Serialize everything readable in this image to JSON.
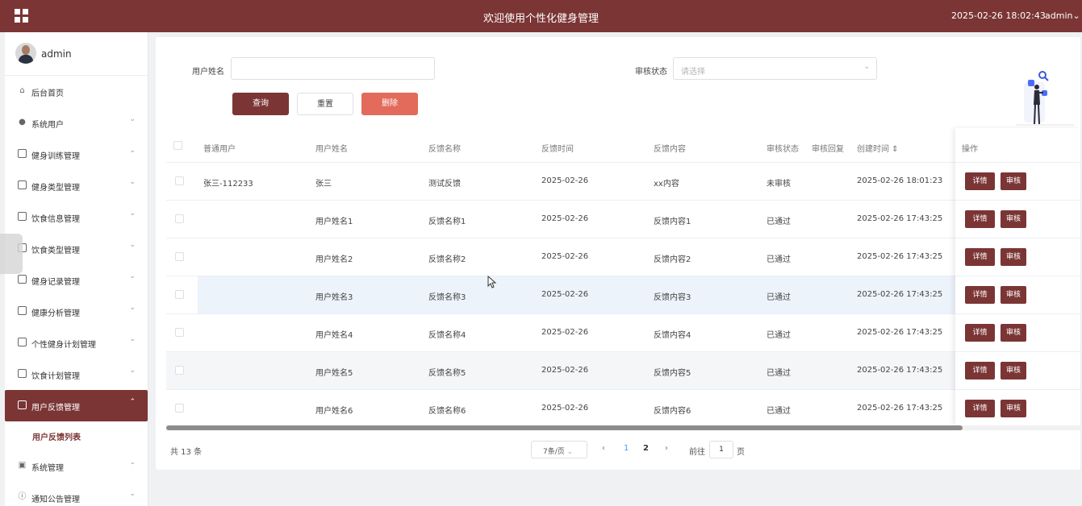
{
  "header": {
    "title": "欢迎使用个性化健身管理",
    "datetime": "2025-02-26 18:02:43",
    "user": "admin",
    "user_chevron": "⌄",
    "brand_color": "#7b3535"
  },
  "sidebar": {
    "username": "admin",
    "items": [
      {
        "label": "后台首页",
        "icon": "home-icon",
        "glyph": "⌂"
      },
      {
        "label": "系统用户",
        "icon": "user-icon",
        "glyph": "●",
        "chev": "⌄"
      },
      {
        "label": "健身训练管理",
        "icon": "doc-icon",
        "chev": "⌄"
      },
      {
        "label": "健身类型管理",
        "icon": "doc-icon",
        "chev": "⌄"
      },
      {
        "label": "饮食信息管理",
        "icon": "doc-icon",
        "chev": "⌄"
      },
      {
        "label": "饮食类型管理",
        "icon": "doc-icon",
        "chev": "⌄"
      },
      {
        "label": "健身记录管理",
        "icon": "doc-icon",
        "chev": "⌄"
      },
      {
        "label": "健康分析管理",
        "icon": "doc-icon",
        "chev": "⌄"
      },
      {
        "label": "个性健身计划管理",
        "icon": "doc-icon",
        "chev": "⌄"
      },
      {
        "label": "饮食计划管理",
        "icon": "doc-icon",
        "chev": "⌄"
      },
      {
        "label": "用户反馈管理",
        "icon": "doc-icon",
        "chev": "⌃",
        "active": true
      },
      {
        "label": "系统管理",
        "icon": "image-icon",
        "glyph": "▣",
        "chev": "⌄"
      },
      {
        "label": "通知公告管理",
        "icon": "info-icon",
        "glyph": "ⓘ",
        "chev": "⌄"
      }
    ],
    "subitem": "用户反馈列表"
  },
  "filters": {
    "username_label": "用户姓名",
    "username_value": "",
    "status_label": "审核状态",
    "status_placeholder": "请选择",
    "status_arrow": "⌄",
    "query": "查询",
    "reset": "重置",
    "delete": "删除"
  },
  "table": {
    "columns": [
      "普通用户",
      "用户姓名",
      "反馈名称",
      "反馈时间",
      "反馈内容",
      "审核状态",
      "审核回复",
      "创建时间 ⇕",
      "操作"
    ],
    "rows": [
      {
        "user": "张三-112233",
        "name": "张三",
        "fb_name": "测试反馈",
        "fb_time": "2025-02-26",
        "content": "xx内容",
        "status": "未审核",
        "reply": "",
        "created": "2025-02-26 18:01:23"
      },
      {
        "user": "",
        "name": "用户姓名1",
        "fb_name": "反馈名称1",
        "fb_time": "2025-02-26",
        "content": "反馈内容1",
        "status": "已通过",
        "reply": "",
        "created": "2025-02-26 17:43:25"
      },
      {
        "user": "",
        "name": "用户姓名2",
        "fb_name": "反馈名称2",
        "fb_time": "2025-02-26",
        "content": "反馈内容2",
        "status": "已通过",
        "reply": "",
        "created": "2025-02-26 17:43:25"
      },
      {
        "user": "",
        "name": "用户姓名3",
        "fb_name": "反馈名称3",
        "fb_time": "2025-02-26",
        "content": "反馈内容3",
        "status": "已通过",
        "reply": "",
        "created": "2025-02-26 17:43:25"
      },
      {
        "user": "",
        "name": "用户姓名4",
        "fb_name": "反馈名称4",
        "fb_time": "2025-02-26",
        "content": "反馈内容4",
        "status": "已通过",
        "reply": "",
        "created": "2025-02-26 17:43:25"
      },
      {
        "user": "",
        "name": "用户姓名5",
        "fb_name": "反馈名称5",
        "fb_time": "2025-02-26",
        "content": "反馈内容5",
        "status": "已通过",
        "reply": "",
        "created": "2025-02-26 17:43:25"
      },
      {
        "user": "",
        "name": "用户姓名6",
        "fb_name": "反馈名称6",
        "fb_time": "2025-02-26",
        "content": "反馈内容6",
        "status": "已通过",
        "reply": "",
        "created": "2025-02-26 17:43:25"
      }
    ],
    "detail_btn": "详情",
    "audit_btn": "审核"
  },
  "pagination": {
    "total": "共 13 条",
    "page_size": "7条/页",
    "size_arrow": "⌄",
    "prev": "‹",
    "pages": [
      "1",
      "2"
    ],
    "next": "›",
    "goto_prefix": "前往",
    "goto_value": "1",
    "goto_suffix": "页"
  }
}
